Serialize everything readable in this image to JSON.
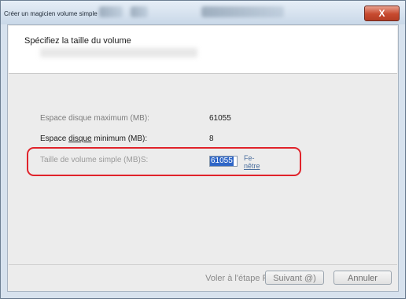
{
  "window": {
    "title": "Créer un magicien volume simple",
    "close_glyph": "X"
  },
  "header": {
    "title": "Spécifiez la taille du volume"
  },
  "rows": {
    "max_label": "Espace disque maximum (MB):",
    "max_value": "61055",
    "min_label_prefix": "Espace ",
    "min_label_underlined": "disque",
    "min_label_suffix": " minimum (MB):",
    "min_value": "8",
    "size_label": "Taille de volume simple (MB)S:",
    "size_value": "61055"
  },
  "side_text": {
    "line1": "Fe-",
    "line2": "nêtre"
  },
  "buttons": {
    "prev_label": "Voler à l'étape P",
    "next_label": "Suivant @)",
    "cancel_label": "Annuler"
  },
  "colors": {
    "highlight_border": "#e0232b",
    "selection": "#2f66c7",
    "close_button": "#c74a2f"
  }
}
